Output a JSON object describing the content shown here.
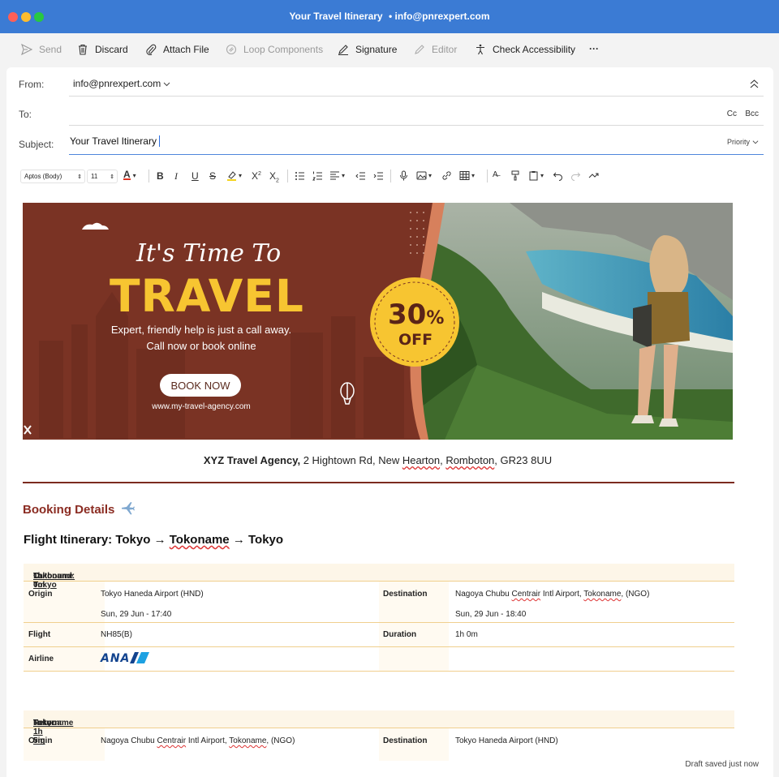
{
  "window": {
    "title_subject": "Your Travel Itinerary",
    "title_account": "• info@pnrexpert.com",
    "traffic_colors": [
      "#ff5f57",
      "#febc2e",
      "#28c840"
    ]
  },
  "toolbar": {
    "send": "Send",
    "discard": "Discard",
    "attach": "Attach File",
    "loop": "Loop Components",
    "signature": "Signature",
    "editor": "Editor",
    "accessibility": "Check Accessibility",
    "more": "···"
  },
  "header": {
    "from_label": "From:",
    "from_value": "info@pnrexpert.com",
    "to_label": "To:",
    "cc": "Cc",
    "bcc": "Bcc",
    "subject_label": "Subject:",
    "subject_value": "Your Travel Itinerary",
    "priority": "Priority"
  },
  "format": {
    "font": "Aptos (Body)",
    "size": "11"
  },
  "banner": {
    "headline_script": "It's Time To",
    "headline": "TRAVEL",
    "tagline1": "Expert, friendly help is just a call away.",
    "tagline2": "Call now or book online",
    "cta": "BOOK NOW",
    "url": "www.my-travel-agency.com",
    "badge_percent": "30",
    "badge_percent_sign": "%",
    "badge_off": "OFF",
    "colors": {
      "brown": "#7a3324",
      "yellow": "#f7c531",
      "coral": "#d7805c"
    }
  },
  "agency": {
    "name": "XYZ Travel Agency,",
    "addr1": " 2 Hightown Rd, New ",
    "hearton": "Hearton",
    "comma1": ", ",
    "romboton": "Romboton",
    "addr2": ", GR23 8UU"
  },
  "booking": {
    "title": "Booking Details",
    "icon": "airplane-icon",
    "itin_a": "Flight Itinerary: Tokyo → ",
    "itin_b": "Tokoname",
    "itin_c": " → Tokyo"
  },
  "outbound": {
    "head_a": "Outbound: Tokyo",
    "head_arrow": " → ",
    "head_b": "Tokoname",
    "head_c": " 1h 0m",
    "origin_label": "Origin",
    "origin": "Tokyo Haneda Airport (HND)",
    "origin_time": "Sun, 29 Jun - 17:40",
    "dest_label": "Destination",
    "dest_a": "Nagoya Chubu ",
    "dest_b": "Centrair",
    "dest_c": " Intl Airport, ",
    "dest_d": "Tokoname",
    "dest_e": ", (NGO)",
    "dest_time": "Sun, 29 Jun - 18:40",
    "flight_label": "Flight",
    "flight": "NH85(B)",
    "duration_label": "Duration",
    "duration": "1h 0m",
    "airline_label": "Airline",
    "airline_logo": "ANA"
  },
  "return": {
    "head_a": "Return: ",
    "head_b": "Tokoname",
    "head_arrow": " → ",
    "head_c": "Tokyo 1h 5m",
    "origin_label": "Origin",
    "origin_a": "Nagoya Chubu ",
    "origin_b": "Centrair",
    "origin_c": " Intl Airport, ",
    "origin_d": "Tokoname",
    "origin_e": ", (NGO)",
    "dest_label": "Destination",
    "dest": "Tokyo Haneda Airport (HND)"
  },
  "status": "Draft saved just now"
}
